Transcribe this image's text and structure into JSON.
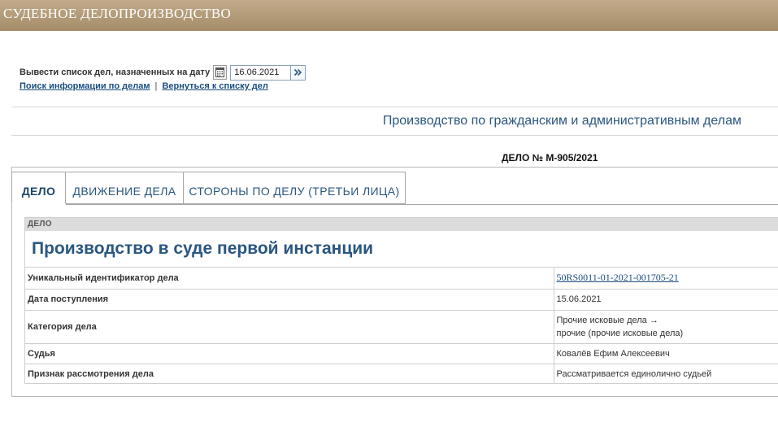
{
  "header": {
    "title": "СУДЕБНОЕ ДЕЛОПРОИЗВОДСТВО"
  },
  "date_filter": {
    "label": "Вывести список дел, назначенных на дату",
    "value": "16.06.2021"
  },
  "links": {
    "search": "Поиск информации по делам",
    "separator": "|",
    "back": "Вернуться к списку дел"
  },
  "section_title": "Производство по гражданским и административным делам",
  "case_number": "ДЕЛО № М-905/2021",
  "tabs": [
    {
      "label": "ДЕЛО",
      "active": true
    },
    {
      "label": "ДВИЖЕНИЕ ДЕЛА",
      "active": false
    },
    {
      "label": "СТОРОНЫ ПО ДЕЛУ (ТРЕТЬИ ЛИЦА)",
      "active": false
    }
  ],
  "card": {
    "head": "ДЕЛО",
    "title": "Производство в суде первой инстанции",
    "rows": [
      {
        "key": "Уникальный идентификатор дела",
        "value": "50RS0011-01-2021-001705-21"
      },
      {
        "key": "Дата поступления",
        "value": "15.06.2021"
      },
      {
        "key": "Категория дела",
        "value_line1": "Прочие исковые дела →",
        "value_line2": "прочие (прочие исковые дела)"
      },
      {
        "key": "Судья",
        "value": "Ковалёв Ефим Алексеевич"
      },
      {
        "key": "Признак рассмотрения дела",
        "value": "Рассматривается единолично судьей"
      }
    ]
  },
  "colors": {
    "header_bar": "#a58c69",
    "link": "#1a4d80",
    "accent_title": "#2a5680"
  },
  "icons": {
    "calendar": "calendar-icon",
    "go": "double-chevron-right-icon"
  }
}
